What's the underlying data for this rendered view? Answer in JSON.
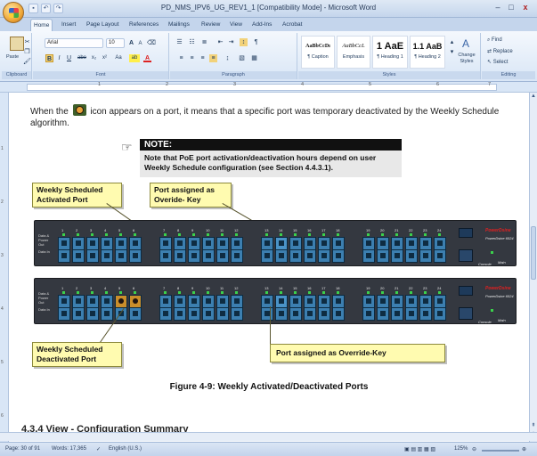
{
  "window": {
    "title": "PD_NMS_IPV6_UG_REV1_1 [Compatibility Mode] - Microsoft Word",
    "min": "–",
    "max": "□",
    "close": "x"
  },
  "tabs": [
    "Home",
    "Insert",
    "Page Layout",
    "References",
    "Mailings",
    "Review",
    "View",
    "Add-Ins",
    "Acrobat"
  ],
  "ribbon": {
    "clipboard": {
      "label": "Clipboard",
      "paste": "Paste"
    },
    "font": {
      "label": "Font",
      "name": "Arial",
      "size": "10",
      "grow": "A",
      "shrink": "A",
      "bold": "B",
      "italic": "I",
      "underline": "U",
      "strike": "abe",
      "sub": "x₂",
      "sup": "x²",
      "case": "Aa",
      "highlight": "ab",
      "color": "A"
    },
    "paragraph": {
      "label": "Paragraph"
    },
    "styles": {
      "label": "Styles",
      "items": [
        {
          "sample": "AaBbCcDı",
          "name": "¶ Caption"
        },
        {
          "sample": "AaBbCcL",
          "name": "Emphasis"
        },
        {
          "sample": "1 AaE",
          "name": "¶ Heading 1"
        },
        {
          "sample": "1.1 AaB",
          "name": "¶ Heading 2"
        }
      ],
      "change": "Change Styles"
    },
    "editing": {
      "label": "Editing",
      "find": "Find",
      "replace": "Replace",
      "select": "Select"
    }
  },
  "ruler": {
    "numbers": [
      "1",
      "2",
      "3",
      "4",
      "5",
      "6",
      "7"
    ]
  },
  "vruler": {
    "numbers": [
      "1",
      "2",
      "3",
      "4",
      "5",
      "6"
    ]
  },
  "document": {
    "para1_before": "When the",
    "para1_after": "icon appears on a port, it means that a specific port was temporary deactivated by the Weekly Schedule algorithm.",
    "note_title": "NOTE:",
    "note_text": "Note that PoE port activation/deactivation hours depend on user Weekly Schedule configuration (see Section 4.4.3.1).",
    "callouts": {
      "weekly_activated": "Weekly Scheduled Activated Port",
      "override_top": "Port assigned as Overide- Key",
      "weekly_deactivated": "Weekly Scheduled Deactivated Port",
      "override_bottom": "Port assigned as Override-Key"
    },
    "switch": {
      "left_labels": "Data & Power Out",
      "left_label2": "Data In",
      "port_numbers": [
        "1",
        "2",
        "3",
        "4",
        "5",
        "6",
        "7",
        "8",
        "9",
        "10",
        "11",
        "12",
        "13",
        "14",
        "15",
        "16",
        "17",
        "18",
        "19",
        "20",
        "21",
        "22",
        "23",
        "24"
      ],
      "console": "Console",
      "main": "Main",
      "brand": "PowerDsine 6024",
      "logo": "PowerDsine"
    },
    "caption": "Figure 4-9: Weekly Activated/Deactivated Ports",
    "section": "4.3.4    View - Configuration Summary"
  },
  "status": {
    "page": "Page: 30 of 91",
    "words": "Words: 17,365",
    "language": "English (U.S.)",
    "zoom": "125%"
  }
}
